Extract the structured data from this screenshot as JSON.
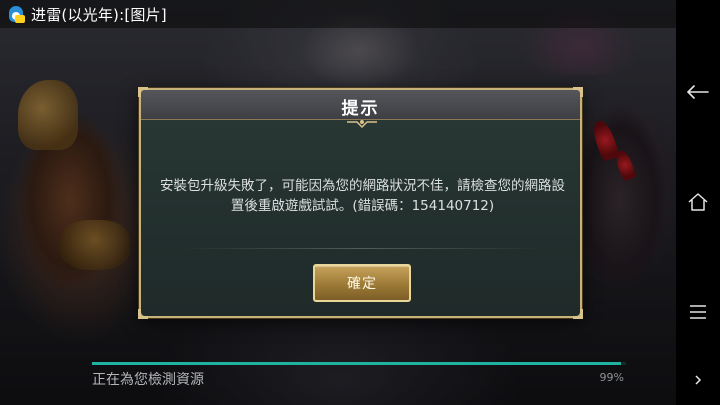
{
  "status_bar": {
    "notification_text": "进雷(以光年):[图片]",
    "app_icon": "qq-penguin-icon"
  },
  "dialog": {
    "title": "提示",
    "message": "安裝包升級失敗了，可能因為您的網路狀況不佳，請檢查您的網路設置後重啟遊戲試試。(錯誤碼：154140712)",
    "confirm_label": "確定"
  },
  "loading": {
    "status_text": "正在為您檢測資源",
    "percent_label": "99%",
    "progress": 0.99
  },
  "navigation_bar": {
    "icons": [
      "back-icon",
      "home-icon",
      "menu-icon",
      "chevron-right-icon"
    ]
  },
  "colors": {
    "button_gold": "#b08c46",
    "progress_teal": "#1fb2a0",
    "dialog_border": "#c9b27a"
  }
}
